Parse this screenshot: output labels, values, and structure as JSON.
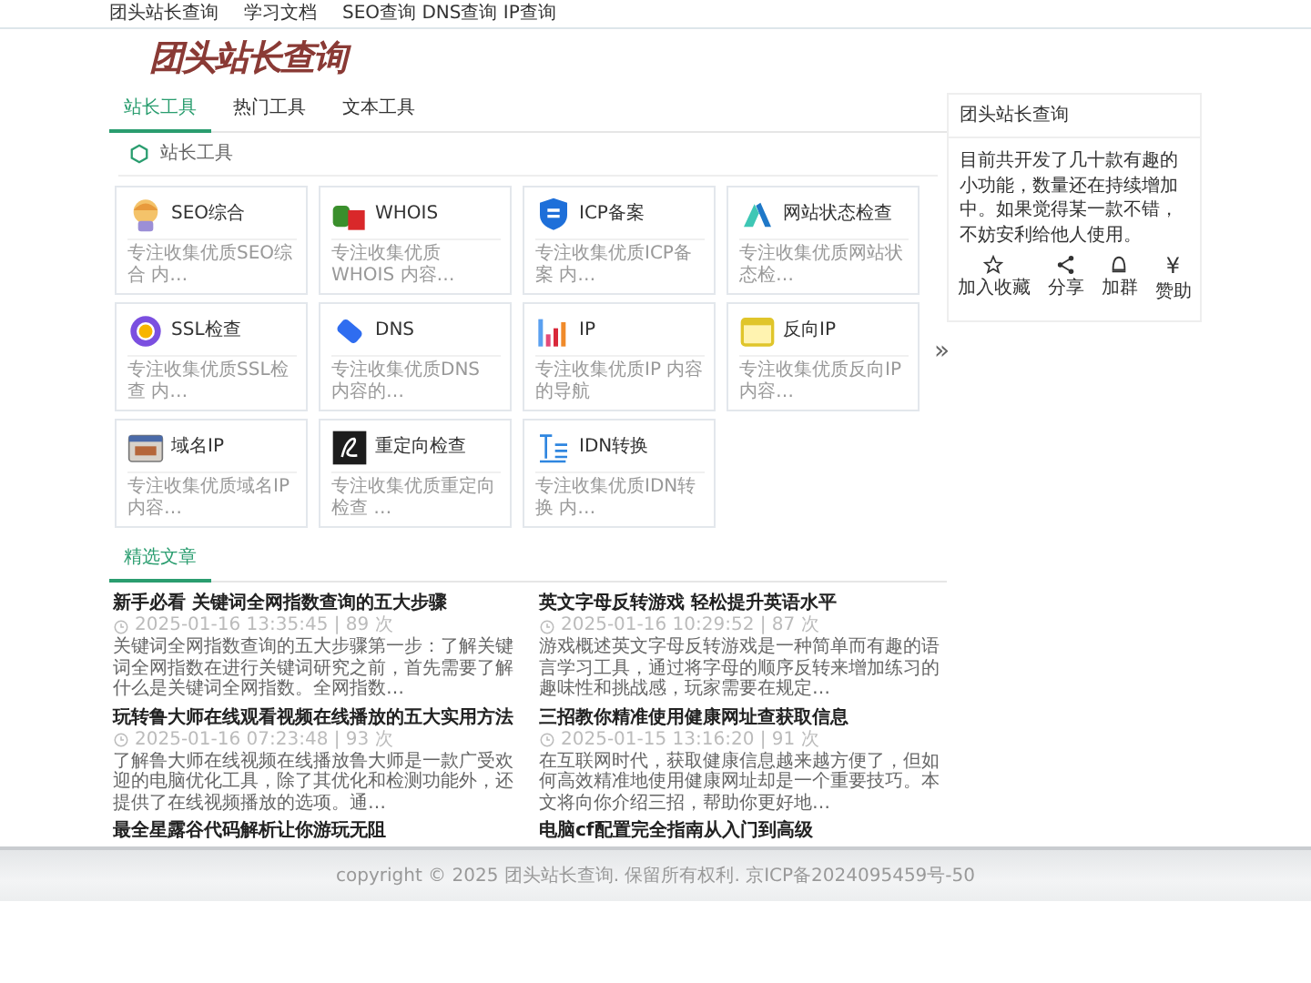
{
  "top_nav": [
    "团头站长查询",
    "学习文档",
    "SEO查询 DNS查询 IP查询"
  ],
  "logo": {
    "text": "团头站长查询"
  },
  "tool_tabs": [
    {
      "label": "站长工具",
      "selected": true
    },
    {
      "label": "热门工具",
      "selected": false
    },
    {
      "label": "文本工具",
      "selected": false
    }
  ],
  "section": {
    "title": "站长工具"
  },
  "tools": [
    {
      "name": "SEO综合",
      "description": "专注收集优质SEO综合 内…"
    },
    {
      "name": "WHOIS",
      "description": "专注收集优质WHOIS 内容…"
    },
    {
      "name": "ICP备案",
      "description": "专注收集优质ICP备案 内…"
    },
    {
      "name": "网站状态检查",
      "description": "专注收集优质网站状态检…"
    },
    {
      "name": "SSL检查",
      "description": "专注收集优质SSL检查 内…"
    },
    {
      "name": "DNS",
      "description": "专注收集优质DNS 内容的…"
    },
    {
      "name": "IP",
      "description": "专注收集优质IP 内容的导航"
    },
    {
      "name": "反向IP",
      "description": "专注收集优质反向IP 内容…"
    },
    {
      "name": "域名IP",
      "description": "专注收集优质域名IP 内容…"
    },
    {
      "name": "重定向检查",
      "description": "专注收集优质重定向检查 …"
    },
    {
      "name": "IDN转换",
      "description": "专注收集优质IDN转换 内…"
    }
  ],
  "more": "»",
  "articles_tab": {
    "label": "精选文章",
    "selected": true
  },
  "articles": [
    {
      "title": "新手必看 关键词全网指数查询的五大步骤",
      "meta": "2025-01-16 13:35:45 | 89 次",
      "excerpt": "关键词全网指数查询的五大步骤第一步：了解关键词全网指数在进行关键词研究之前，首先需要了解什么是关键词全网指数。全网指数…"
    },
    {
      "title": "英文字母反转游戏 轻松提升英语水平",
      "meta": "2025-01-16 10:29:52 | 87 次",
      "excerpt": "游戏概述英文字母反转游戏是一种简单而有趣的语言学习工具，通过将字母的顺序反转来增加练习的趣味性和挑战感，玩家需要在规定…"
    },
    {
      "title": "玩转鲁大师在线观看视频在线播放的五大实用方法",
      "meta": "2025-01-16 07:23:48 | 93 次",
      "excerpt": "了解鲁大师在线视频在线播放鲁大师是一款广受欢迎的电脑优化工具，除了其优化和检测功能外，还提供了在线视频播放的选项。通…"
    },
    {
      "title": "三招教你精准使用健康网址查获取信息",
      "meta": "2025-01-15 13:16:20 | 91 次",
      "excerpt": "在互联网时代，获取健康信息越来越方便了，但如何高效精准地使用健康网址却是一个重要技巧。本文将向你介绍三招，帮助你更好地…"
    },
    {
      "title": "最全星露谷代码解析让你游玩无阻"
    },
    {
      "title": "电脑cf配置完全指南从入门到高级"
    }
  ],
  "sidebar": {
    "title": "团头站长查询",
    "text": "目前共开发了几十款有趣的小功能，数量还在持续增加中。如果觉得某一款不错，不妨安利给他人使用。",
    "actions": [
      {
        "kind": "star",
        "label": "加入收藏"
      },
      {
        "kind": "share",
        "label": "分享"
      },
      {
        "kind": "group",
        "label": "加群"
      },
      {
        "kind": "glyph",
        "glyph": "¥",
        "label": "赞助"
      }
    ]
  },
  "footer": {
    "text": "copyright © 2025 团头站长查询. 保留所有权利.  京ICP备2024095459号-50"
  }
}
